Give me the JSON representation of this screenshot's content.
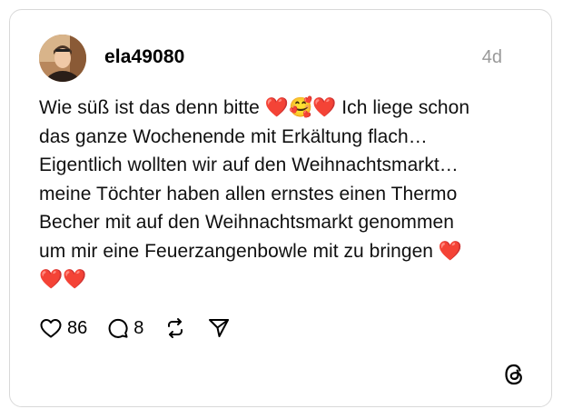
{
  "post": {
    "username": "ela49080",
    "timestamp": "4d",
    "text": "Wie süß ist das denn bitte ❤️🥰❤️ Ich liege schon\ndas ganze Wochenende mit Erkältung flach…\nEigentlich wollten wir auf den Weihnachtsmarkt…\nmeine Töchter haben allen ernstes einen Thermo\nBecher mit auf den Weihnachtsmarkt genommen\num mir eine Feuerzangenbowle mit zu bringen ❤️\n❤️❤️",
    "like_count": "86",
    "reply_count": "8"
  },
  "icons": {
    "like": "heart-icon",
    "reply": "speech-bubble-icon",
    "repost": "repost-icon",
    "share": "send-icon",
    "brand": "threads-logo-icon"
  },
  "colors": {
    "text": "#101010",
    "muted": "#999999",
    "border": "#d9d9d9",
    "heart": "#e8192c"
  }
}
